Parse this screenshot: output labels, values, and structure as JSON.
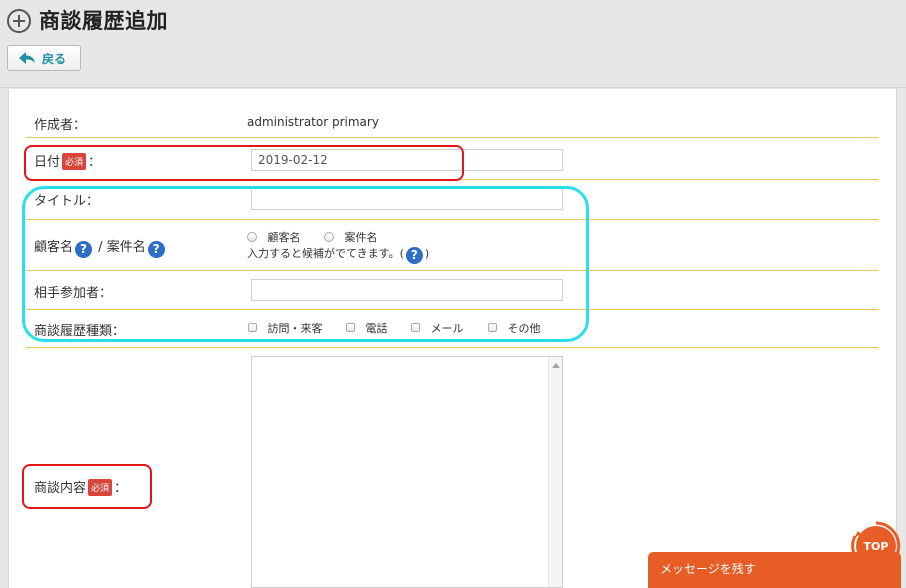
{
  "header": {
    "title": "商談履歴追加",
    "back_label": "戻る"
  },
  "form": {
    "creator_label": "作成者：",
    "creator_value": "administrator primary",
    "date_label": "日付",
    "date_value": "2019-02-12",
    "required_badge": "必須",
    "colon": "：",
    "title_label": "タイトル：",
    "customer_label": "顧客名",
    "slash": "/",
    "case_label": "案件名",
    "radio_customer": "顧客名",
    "radio_case": "案件名",
    "candidate_hint": "入力すると候補がでてきます。(",
    "candidate_hint_end": ")",
    "participants_label": "相手参加者：",
    "type_label": "商談履歴種類：",
    "type_options": [
      "訪問・来客",
      "電話",
      "メール",
      "その他"
    ],
    "content_label": "商談内容",
    "help_glyph": "?"
  },
  "footer": {
    "message_label": "メッセージを残す",
    "top_label": "TOP"
  },
  "colors": {
    "required": "#d9453b",
    "help": "#2d6ec6",
    "divider": "#e8c65c",
    "message_bar": "#e85d25",
    "highlight_red": "#e3151b",
    "highlight_cyan": "#27e0ee"
  }
}
